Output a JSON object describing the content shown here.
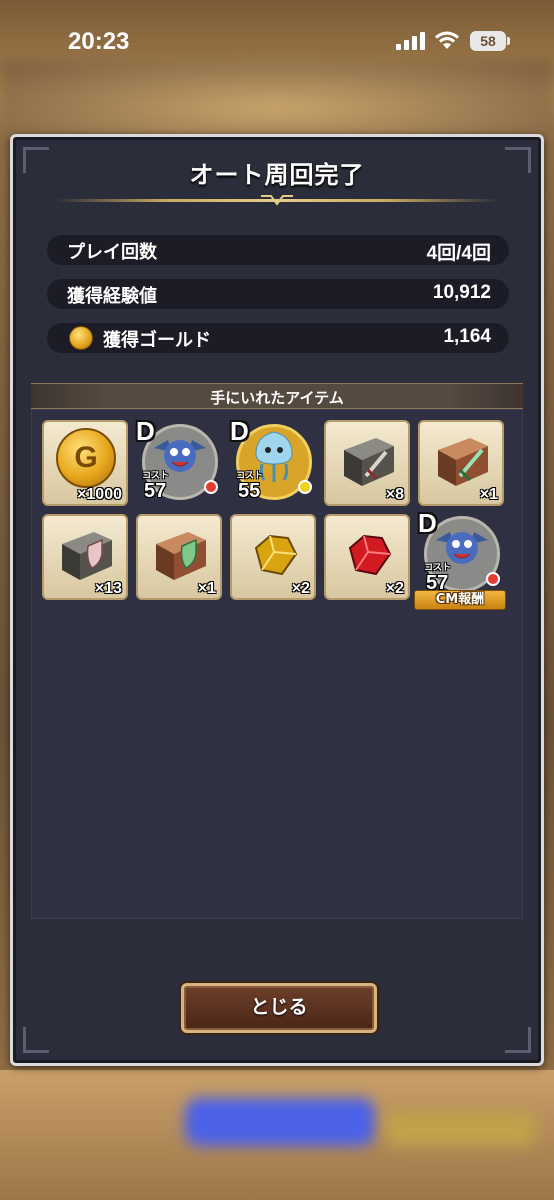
{
  "status_bar": {
    "time": "20:23",
    "battery": "58"
  },
  "dialog": {
    "title": "オート周回完了",
    "stats": [
      {
        "label": "プレイ回数",
        "value": "4回/4回"
      },
      {
        "label": "獲得経験値",
        "value": "10,912"
      },
      {
        "label": "獲得ゴールド",
        "value": "1,164",
        "icon": "gold-coin-icon"
      }
    ],
    "items_header": "手にいれたアイテム",
    "items": [
      {
        "type": "gold-coin",
        "icon": "gold-coin-icon",
        "coin_letter": "G",
        "qty": "×1000"
      },
      {
        "type": "monster",
        "icon": "dracky-monster-icon",
        "rank": "D",
        "cost_label": "コスト",
        "cost": "57",
        "element_color": "#e33b2e"
      },
      {
        "type": "monster",
        "icon": "healslime-monster-icon",
        "rank": "D",
        "cost_label": "コスト",
        "cost": "55",
        "element_color": "#f2d21b"
      },
      {
        "type": "material",
        "icon": "dagger-ingot-icon",
        "qty": "×8"
      },
      {
        "type": "material",
        "icon": "sword-ingot-icon",
        "qty": "×1"
      },
      {
        "type": "material",
        "icon": "shield-ingot-icon",
        "qty": "×13"
      },
      {
        "type": "material",
        "icon": "green-shield-ingot-icon",
        "qty": "×1"
      },
      {
        "type": "gem",
        "icon": "yellow-gem-icon",
        "qty": "×2"
      },
      {
        "type": "gem",
        "icon": "red-gem-icon",
        "qty": "×2"
      },
      {
        "type": "monster",
        "icon": "dracky-monster-icon",
        "rank": "D",
        "cost_label": "コスト",
        "cost": "57",
        "element_color": "#e33b2e",
        "badge": "CM報酬"
      }
    ],
    "close_button": "とじる"
  },
  "colors": {
    "panel_bg": "#2b2d3a",
    "row_bg": "#1b1c25",
    "accent_gold": "#c9a862",
    "button_bg": "#5a3020"
  }
}
